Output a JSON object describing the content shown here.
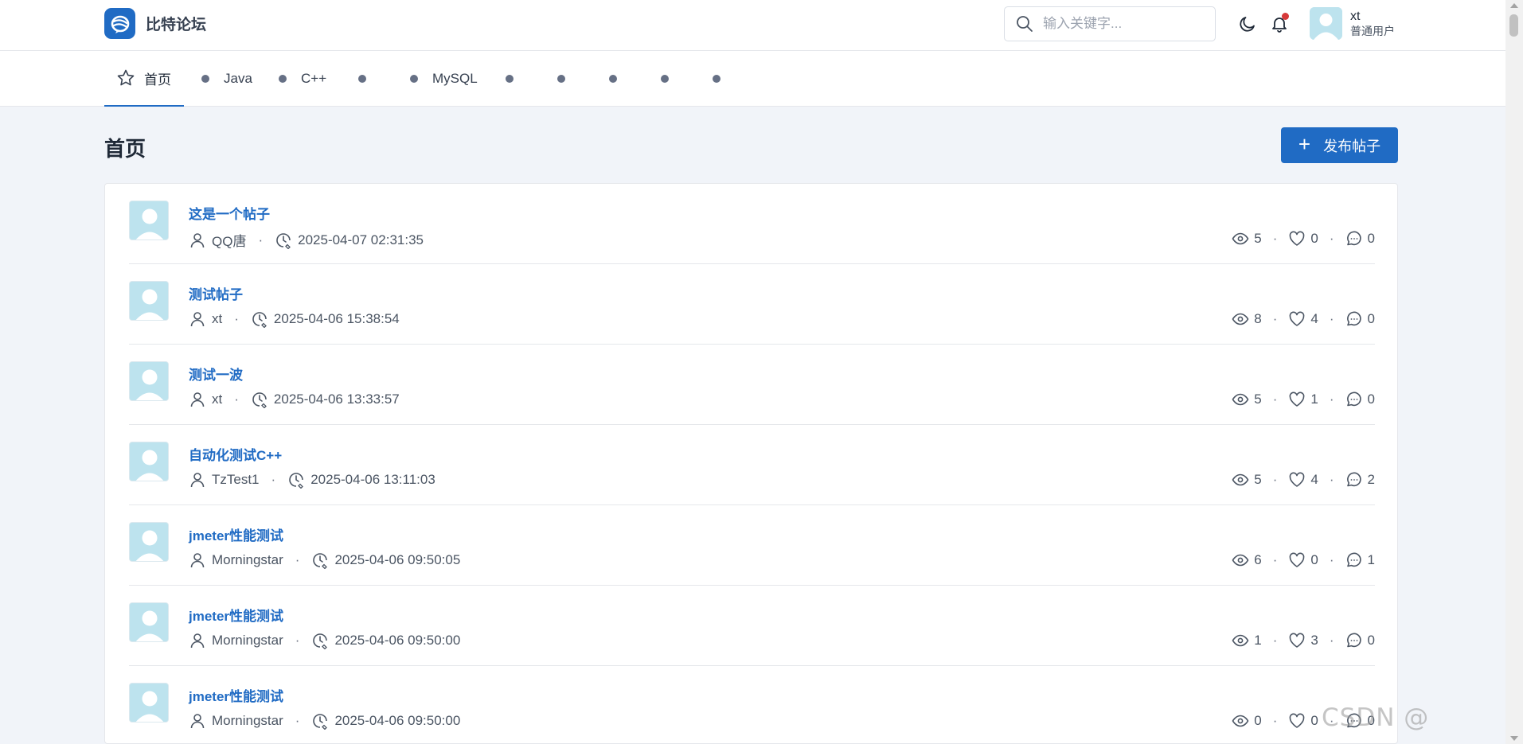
{
  "colors": {
    "accent": "#206bc4",
    "notification": "#d63939",
    "avatar_bg": "#bde3ee"
  },
  "header": {
    "logo_text": "比特论坛",
    "search_placeholder": "输入关键字...",
    "user": {
      "name": "xt",
      "role": "普通用户"
    }
  },
  "nav": {
    "items": [
      {
        "label": "首页",
        "icon": "star-icon"
      },
      {
        "label": "Java",
        "icon": "dot"
      },
      {
        "label": "C++",
        "icon": "dot"
      },
      {
        "label": "",
        "icon": "dot"
      },
      {
        "label": "MySQL",
        "icon": "dot"
      },
      {
        "label": "",
        "icon": "dot"
      },
      {
        "label": "",
        "icon": "dot"
      },
      {
        "label": "",
        "icon": "dot"
      },
      {
        "label": "",
        "icon": "dot"
      },
      {
        "label": "",
        "icon": "dot"
      }
    ]
  },
  "main": {
    "title": "首页",
    "publish_label": "发布帖子",
    "posts": [
      {
        "title": "这是一个帖子",
        "author": "QQ唐",
        "time": "2025-04-07 02:31:35",
        "views": "5",
        "likes": "0",
        "comments": "0"
      },
      {
        "title": "测试帖子",
        "author": "xt",
        "time": "2025-04-06 15:38:54",
        "views": "8",
        "likes": "4",
        "comments": "0"
      },
      {
        "title": "测试一波",
        "author": "xt",
        "time": "2025-04-06 13:33:57",
        "views": "5",
        "likes": "1",
        "comments": "0"
      },
      {
        "title": "自动化测试C++",
        "author": "TzTest1",
        "time": "2025-04-06 13:11:03",
        "views": "5",
        "likes": "4",
        "comments": "2"
      },
      {
        "title": "jmeter性能测试",
        "author": "Morningstar",
        "time": "2025-04-06 09:50:05",
        "views": "6",
        "likes": "0",
        "comments": "1"
      },
      {
        "title": "jmeter性能测试",
        "author": "Morningstar",
        "time": "2025-04-06 09:50:00",
        "views": "1",
        "likes": "3",
        "comments": "0"
      },
      {
        "title": "jmeter性能测试",
        "author": "Morningstar",
        "time": "2025-04-06 09:50:00",
        "views": "0",
        "likes": "0",
        "comments": "0"
      }
    ]
  },
  "watermark": "CSDN @"
}
